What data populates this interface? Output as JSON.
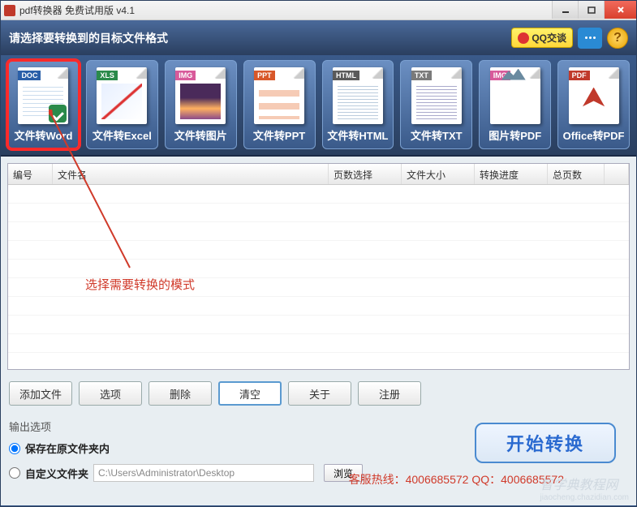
{
  "title": "pdf转换器 免费试用版 v4.1",
  "header_prompt": "请选择要转换到的目标文件格式",
  "qq_label": "QQ交谈",
  "help_glyph": "?",
  "tiles": [
    {
      "tag": "DOC",
      "label": "文件转Word",
      "body": "txt",
      "selected": true,
      "check": true
    },
    {
      "tag": "XLS",
      "label": "文件转Excel",
      "body": "chart"
    },
    {
      "tag": "IMG",
      "label": "文件转图片",
      "body": "photo"
    },
    {
      "tag": "PPT",
      "label": "文件转PPT",
      "body": "ppt"
    },
    {
      "tag": "HTML",
      "label": "文件转HTML",
      "body": "html"
    },
    {
      "tag": "TXT",
      "label": "文件转TXT",
      "body": "txt2"
    },
    {
      "tag": "IMG",
      "label": "图片转PDF",
      "body": "img2"
    },
    {
      "tag": "PDF",
      "label": "Office转PDF",
      "body": "pdf"
    }
  ],
  "tile_tag_class": [
    "doc-c",
    "xls-c",
    "img-c",
    "ppt-c",
    "htm-c",
    "txt-c",
    "img-c",
    "pdf-c"
  ],
  "columns": {
    "c0": "编号",
    "c1": "文件名",
    "c2": "页数选择",
    "c3": "文件大小",
    "c4": "转换进度",
    "c5": "总页数"
  },
  "buttons": {
    "add": "添加文件",
    "opt": "选项",
    "del": "删除",
    "clear": "清空",
    "about": "关于",
    "reg": "注册"
  },
  "output_label": "输出选项",
  "radio_same": "保存在原文件夹内",
  "radio_custom": "自定义文件夹",
  "path_value": "C:\\Users\\Administrator\\Desktop",
  "browse": "浏览",
  "start": "开始转换",
  "hotline": "客服热线：4006685572 QQ：4006685572",
  "annotation": "选择需要转换的模式",
  "watermark": "智学典教程网",
  "watermark_sub": "jiaocheng.chazidian.com"
}
